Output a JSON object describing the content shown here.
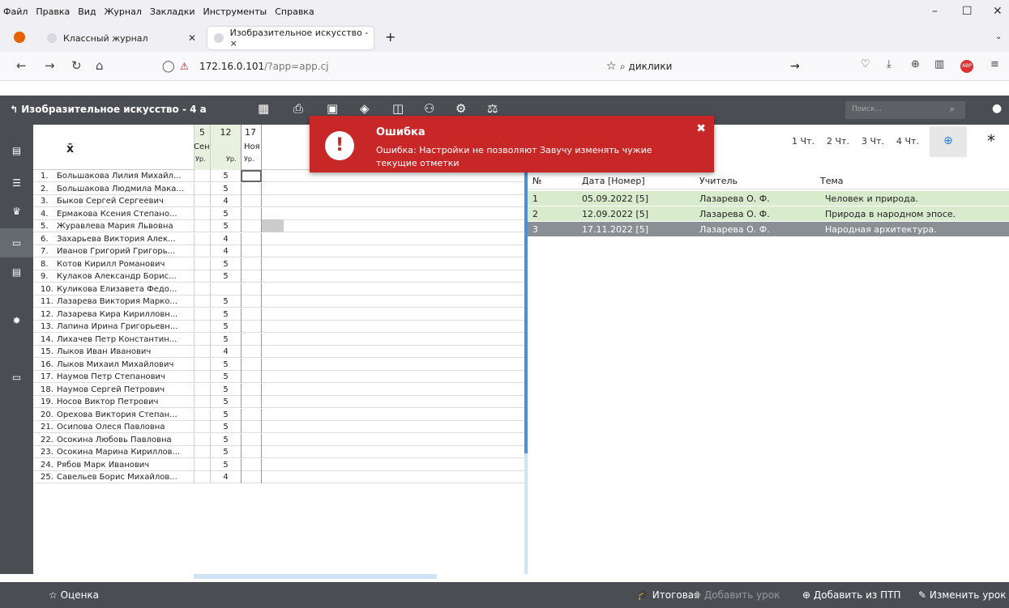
{
  "browser": {
    "menu": [
      "Файл",
      "Правка",
      "Вид",
      "Журнал",
      "Закладки",
      "Инструменты",
      "Справка"
    ],
    "tabs": [
      {
        "title": "Классный журнал"
      },
      {
        "title": "Изобразительное искусство - ×"
      }
    ],
    "url_host": "172.16.0.101",
    "url_path": "/?app=app.cj",
    "search": "диклики"
  },
  "app": {
    "title": "Изобразительное искусство - 4 а",
    "search_placeholder": "Поиск..."
  },
  "grid": {
    "header": {
      "col1_num": "5",
      "col1_mon": "Сен",
      "col1_sub": "Ур.",
      "col2_num": "12",
      "col2_sub": "Ур.",
      "col3_num": "17",
      "col3_mon": "Ноя",
      "col3_sub": "Ур."
    },
    "students": [
      {
        "num": "1.",
        "name": "Большакова Лилия Михайл...",
        "mark": "5"
      },
      {
        "num": "2.",
        "name": "Большакова Людмила Мака...",
        "mark": "5"
      },
      {
        "num": "3.",
        "name": "Быков Сергей Сергеевич",
        "mark": "4"
      },
      {
        "num": "4.",
        "name": "Ермакова Ксения Степано...",
        "mark": "5"
      },
      {
        "num": "5.",
        "name": "Журавлева Мария Львовна",
        "mark": "5"
      },
      {
        "num": "6.",
        "name": "Захарьева Виктория Алек...",
        "mark": "4"
      },
      {
        "num": "7.",
        "name": "Иванов Григорий Григорь...",
        "mark": "4"
      },
      {
        "num": "8.",
        "name": "Котов Кирилл Романович",
        "mark": "5"
      },
      {
        "num": "9.",
        "name": "Кулаков Александр Борис...",
        "mark": "5"
      },
      {
        "num": "10.",
        "name": "Куликова Елизавета Федо...",
        "mark": ""
      },
      {
        "num": "11.",
        "name": "Лазарева Виктория Марко...",
        "mark": "5"
      },
      {
        "num": "12.",
        "name": "Лазарева Кира Кирилловн...",
        "mark": "5"
      },
      {
        "num": "13.",
        "name": "Лапина Ирина Григорьевн...",
        "mark": "5"
      },
      {
        "num": "14.",
        "name": "Лихачев Петр Константин...",
        "mark": "5"
      },
      {
        "num": "15.",
        "name": "Лыков Иван Иванович",
        "mark": "4"
      },
      {
        "num": "16.",
        "name": "Лыков Михаил Михайлович",
        "mark": "5"
      },
      {
        "num": "17.",
        "name": "Наумов Петр Степанович",
        "mark": "5"
      },
      {
        "num": "18.",
        "name": "Наумов Сергей Петрович",
        "mark": "5"
      },
      {
        "num": "19.",
        "name": "Носов Виктор Петрович",
        "mark": "5"
      },
      {
        "num": "20.",
        "name": "Орехова Виктория Степан...",
        "mark": "5"
      },
      {
        "num": "21.",
        "name": "Осипова Олеся Павловна",
        "mark": "5"
      },
      {
        "num": "22.",
        "name": "Осокина Любовь Павловна",
        "mark": "5"
      },
      {
        "num": "23.",
        "name": "Осокина Марина Кириллов...",
        "mark": "5"
      },
      {
        "num": "24.",
        "name": "Рябов Марк Иванович",
        "mark": "5"
      },
      {
        "num": "25.",
        "name": "Савельев Борис Михайлов...",
        "mark": "4"
      }
    ]
  },
  "right": {
    "tabs": [
      "1 Чт.",
      "2 Чт.",
      "3 Чт.",
      "4 Чт."
    ],
    "columns": {
      "num": "№",
      "date": "Дата [Номер]",
      "teacher": "Учитель",
      "topic": "Тема"
    },
    "lessons": [
      {
        "n": "1",
        "date": "05.09.2022 [5]",
        "teacher": "Лазарева О. Ф.",
        "topic": "Человек и природа."
      },
      {
        "n": "2",
        "date": "12.09.2022 [5]",
        "teacher": "Лазарева О. Ф.",
        "topic": "Природа в народном эпосе."
      },
      {
        "n": "3",
        "date": "17.11.2022 [5]",
        "teacher": "Лазарева О. Ф.",
        "topic": "Народная архитектура."
      }
    ]
  },
  "footer": {
    "grade": "Оценка",
    "final": "Итоговая",
    "add_lesson": "Добавить урок",
    "add_ptp": "Добавить из ПТП",
    "edit_lesson": "Изменить урок"
  },
  "error": {
    "title": "Ошибка",
    "message": "Ошибка: Настройки не позволяют Завучу изменять чужие текущие отметки",
    "icon": "!"
  },
  "colors": {
    "header": "#4a4e52",
    "error": "#c82727",
    "row_green": "#d9ebcd",
    "row_selected": "#8a8f93",
    "accent": "#4a90d9"
  }
}
